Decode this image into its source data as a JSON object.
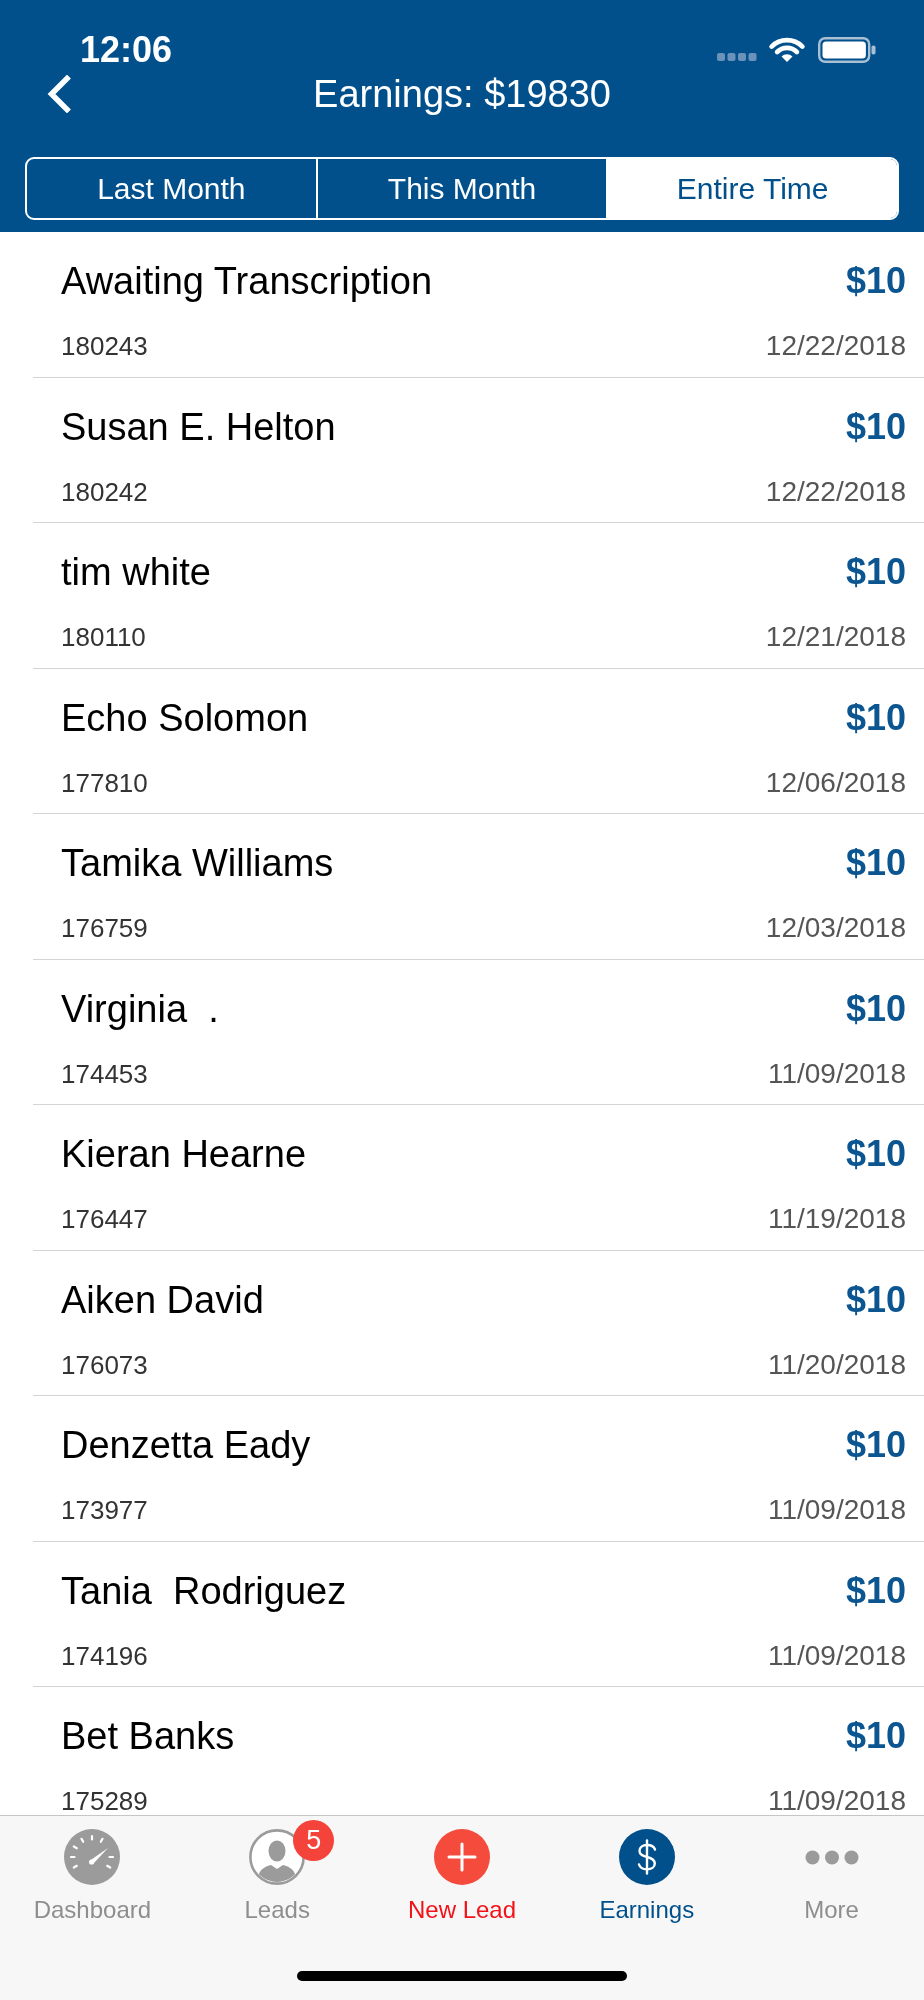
{
  "status_bar": {
    "time": "12:06"
  },
  "nav": {
    "title": "Earnings: $19830"
  },
  "segments": [
    {
      "label": "Last Month",
      "selected": false
    },
    {
      "label": "This Month",
      "selected": false
    },
    {
      "label": "Entire Time",
      "selected": true
    }
  ],
  "entries": [
    {
      "name": "Awaiting Transcription",
      "amount": "$10",
      "id": "180243",
      "date": "12/22/2018"
    },
    {
      "name": "Susan E. Helton",
      "amount": "$10",
      "id": "180242",
      "date": "12/22/2018"
    },
    {
      "name": "tim white",
      "amount": "$10",
      "id": "180110",
      "date": "12/21/2018"
    },
    {
      "name": "Echo Solomon",
      "amount": "$10",
      "id": "177810",
      "date": "12/06/2018"
    },
    {
      "name": "Tamika Williams",
      "amount": "$10",
      "id": "176759",
      "date": "12/03/2018"
    },
    {
      "name": "Virginia  .",
      "amount": "$10",
      "id": "174453",
      "date": "11/09/2018"
    },
    {
      "name": "Kieran Hearne",
      "amount": "$10",
      "id": "176447",
      "date": "11/19/2018"
    },
    {
      "name": "Aiken David",
      "amount": "$10",
      "id": "176073",
      "date": "11/20/2018"
    },
    {
      "name": "Denzetta Eady",
      "amount": "$10",
      "id": "173977",
      "date": "11/09/2018"
    },
    {
      "name": "Tania  Rodriguez",
      "amount": "$10",
      "id": "174196",
      "date": "11/09/2018"
    },
    {
      "name": "Bet Banks",
      "amount": "$10",
      "id": "175289",
      "date": "11/09/2018"
    }
  ],
  "tab_bar": {
    "items": [
      {
        "label": "Dashboard",
        "kind": "dashboard",
        "selected": false
      },
      {
        "label": "Leads",
        "kind": "leads",
        "badge": "5",
        "selected": false
      },
      {
        "label": "New Lead",
        "kind": "new",
        "selected": false
      },
      {
        "label": "Earnings",
        "kind": "earnings",
        "selected": true
      },
      {
        "label": "More",
        "kind": "more",
        "selected": false
      }
    ]
  }
}
